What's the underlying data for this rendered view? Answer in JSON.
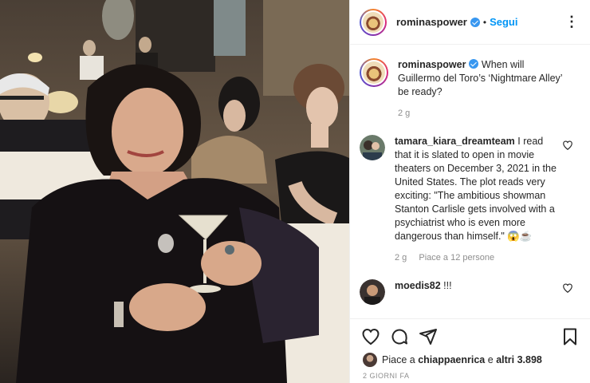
{
  "header": {
    "username": "rominaspower",
    "separator": "•",
    "follow_label": "Segui",
    "more_icon": "more-icon"
  },
  "caption": {
    "username": "rominaspower",
    "text": "When will Guillermo del Toro’s ‘Nightmare Alley’ be ready?",
    "time": "2 g"
  },
  "comments": [
    {
      "username": "tamara_kiara_dreamteam",
      "text": "I read that it is slated to open in movie theaters on December 3, 2021 in the United States. The plot reads very exciting: \"The ambitious showman Stanton Carlisle gets involved with a psychiatrist who is even more dangerous than himself.\" 😱☕",
      "time": "2 g",
      "likes": "Piace a 12 persone"
    },
    {
      "username": "moedis82",
      "text": "!!!"
    }
  ],
  "likes": {
    "prefix": "Piace a",
    "user": "chiappaenrica",
    "middle": "e",
    "others": "altri 3.898"
  },
  "date": "2 GIORNI FA",
  "colors": {
    "link": "#0095f6",
    "verified": "#3897f0",
    "muted": "#8e8e8e"
  }
}
